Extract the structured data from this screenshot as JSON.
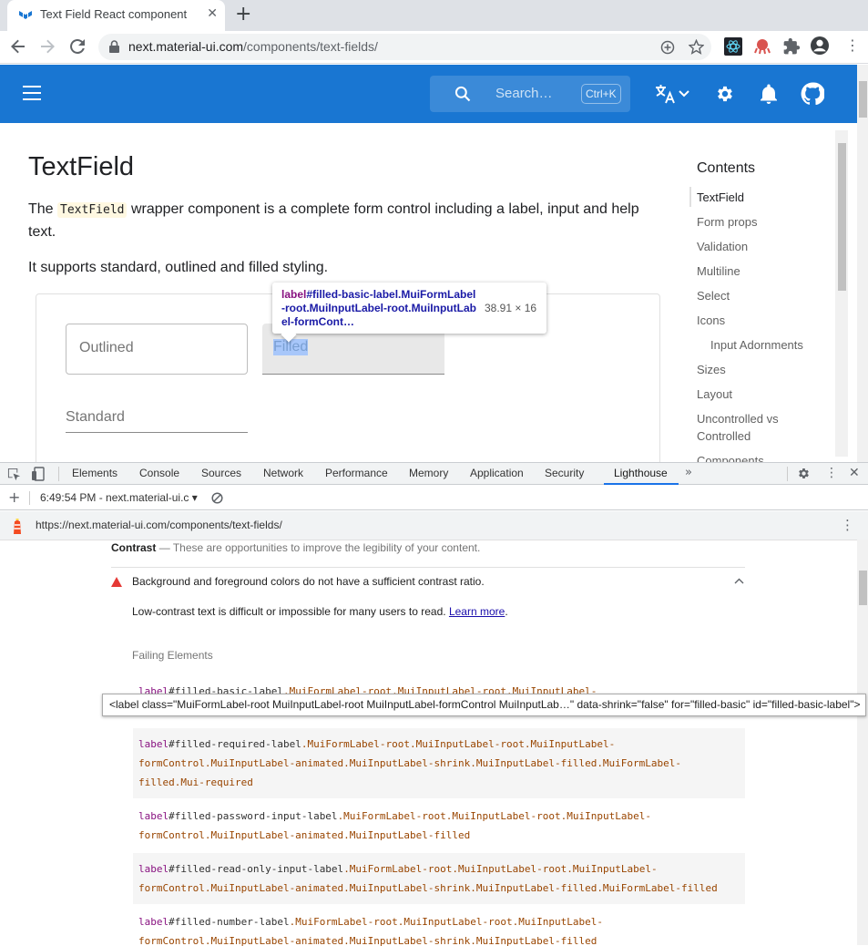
{
  "browser": {
    "tab_title": "Text Field React component",
    "url_host": "next.material-ui.com",
    "url_path": "/components/text-fields/"
  },
  "appbar": {
    "search_placeholder": "Search…",
    "search_shortcut": "Ctrl+K",
    "color": "#1976d2"
  },
  "article": {
    "title": "TextField",
    "intro_pre": "The",
    "intro_code": "TextField",
    "intro_post": "wrapper component is a complete form control including a label, input and help text.",
    "subtitle": "It supports standard, outlined and filled styling.",
    "fields": {
      "outlined": "Outlined",
      "filled": "Filled",
      "standard": "Standard"
    }
  },
  "toc": {
    "heading": "Contents",
    "items": [
      "TextField",
      "Form props",
      "Validation",
      "Multiline",
      "Select",
      "Icons",
      "Input Adornments",
      "Sizes",
      "Layout",
      "Uncontrolled vs",
      "Controlled",
      "Components"
    ]
  },
  "inspect_tooltip": {
    "tag": "label",
    "selector": "#filled-basic-label.MuiFormLabel-root.MuiInputLabel-root.MuiInputLabel-formCont…",
    "dimensions": "38.91 × 16"
  },
  "devtools": {
    "tabs": [
      "Elements",
      "Console",
      "Sources",
      "Network",
      "Performance",
      "Memory",
      "Application",
      "Security",
      "Lighthouse"
    ],
    "active_tab": "Lighthouse",
    "report_label": "6:49:54 PM - next.material-ui.c",
    "report_url": "https://next.material-ui.com/components/text-fields/",
    "section_title": "Contrast",
    "section_desc": "These are opportunities to improve the legibility of your content.",
    "audit_title": "Background and foreground colors do not have a sufficient contrast ratio.",
    "audit_desc": "Low-contrast text is difficult or impossible for many users to read.",
    "learn_more": "Learn more",
    "failing_label": "Failing Elements",
    "failing": [
      {
        "tag": "label",
        "id": "#filled-basic-label",
        "classes": ".MuiFormLabel-root.MuiInputLabel-root.MuiInputLabel-"
      },
      {
        "tag": "label",
        "id": "#filled-required-label",
        "classes": ".MuiFormLabel-root.MuiInputLabel-root.MuiInputLabel-formControl.MuiInputLabel-animated.MuiInputLabel-shrink.MuiInputLabel-filled.MuiFormLabel-filled.Mui-required"
      },
      {
        "tag": "label",
        "id": "#filled-password-input-label",
        "classes": ".MuiFormLabel-root.MuiInputLabel-root.MuiInputLabel-formControl.MuiInputLabel-animated.MuiInputLabel-filled"
      },
      {
        "tag": "label",
        "id": "#filled-read-only-input-label",
        "classes": ".MuiFormLabel-root.MuiInputLabel-root.MuiInputLabel-formControl.MuiInputLabel-animated.MuiInputLabel-shrink.MuiInputLabel-filled.MuiFormLabel-filled"
      },
      {
        "tag": "label",
        "id": "#filled-number-label",
        "classes": ".MuiFormLabel-root.MuiInputLabel-root.MuiInputLabel-formControl.MuiInputLabel-animated.MuiInputLabel-shrink.MuiInputLabel-filled"
      }
    ],
    "html_tooltip": "<label class=\"MuiFormLabel-root MuiInputLabel-root MuiInputLabel-formControl MuiInputLab…\" data-shrink=\"false\" for=\"filled-basic\" id=\"filled-basic-label\">"
  }
}
